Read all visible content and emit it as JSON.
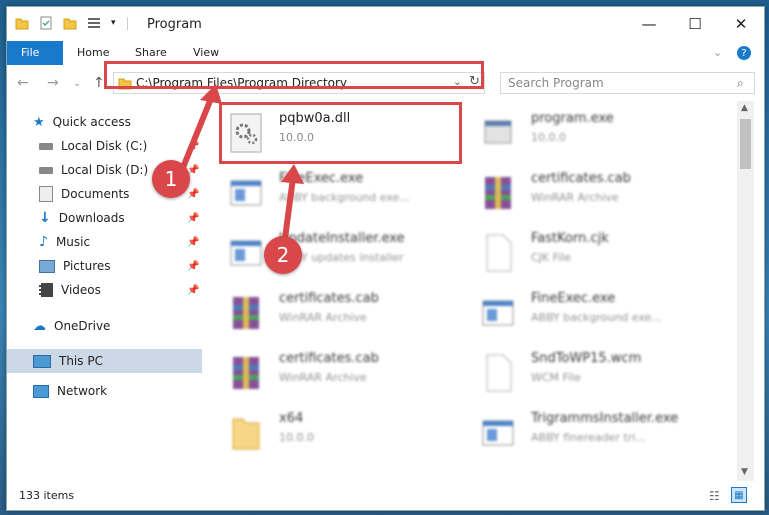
{
  "window": {
    "title": "Program"
  },
  "ribbon": {
    "tabs": [
      "File",
      "Home",
      "Share",
      "View"
    ]
  },
  "address": {
    "path": "C:\\Program Files\\Program Directory"
  },
  "search": {
    "placeholder": "Search Program"
  },
  "nav": {
    "items": [
      {
        "label": "Quick access",
        "icon": "star-icon",
        "pinned": false
      },
      {
        "label": "Local Disk (C:)",
        "icon": "drive-icon",
        "pinned": true
      },
      {
        "label": "Local Disk (D:)",
        "icon": "drive-icon",
        "pinned": true
      },
      {
        "label": "Documents",
        "icon": "documents-icon",
        "pinned": true
      },
      {
        "label": "Downloads",
        "icon": "download-icon",
        "pinned": true
      },
      {
        "label": "Music",
        "icon": "music-icon",
        "pinned": true
      },
      {
        "label": "Pictures",
        "icon": "pictures-icon",
        "pinned": true
      },
      {
        "label": "Videos",
        "icon": "videos-icon",
        "pinned": true
      },
      {
        "label": "OneDrive",
        "icon": "cloud-icon",
        "pinned": false
      },
      {
        "label": "This PC",
        "icon": "computer-icon",
        "pinned": false,
        "selected": true
      },
      {
        "label": "Network",
        "icon": "network-icon",
        "pinned": false
      }
    ]
  },
  "files": [
    {
      "name": "pqbw0a.dll",
      "sub": "10.0.0",
      "icon": "dll-gear-icon"
    },
    {
      "name": "program.exe",
      "sub": "10.0.0",
      "icon": "exe-icon"
    },
    {
      "name": "FineExec.exe",
      "sub": "ABBY background exe...",
      "icon": "window-icon"
    },
    {
      "name": "certificates.cab",
      "sub": "WinRAR Archive",
      "icon": "archive-icon"
    },
    {
      "name": "UpdateInstaller.exe",
      "sub": "ABBY updates installer",
      "icon": "window-icon"
    },
    {
      "name": "FastKorn.cjk",
      "sub": "CJK File",
      "icon": "blank-file-icon"
    },
    {
      "name": "certificates.cab",
      "sub": "WinRAR Archive",
      "icon": "archive-icon"
    },
    {
      "name": "FineExec.exe",
      "sub": "ABBY background exe...",
      "icon": "window-icon"
    },
    {
      "name": "certificates.cab",
      "sub": "WinRAR Archive",
      "icon": "archive-icon"
    },
    {
      "name": "SndToWP15.wcm",
      "sub": "WCM File",
      "icon": "blank-file-icon"
    },
    {
      "name": "x64",
      "sub": "10.0.0",
      "icon": "folder-icon"
    },
    {
      "name": "TrigrammsInstaller.exe",
      "sub": "ABBY finereader tri...",
      "icon": "window-icon"
    }
  ],
  "status": {
    "count": "133 items"
  },
  "annotations": {
    "step1": "1",
    "step2": "2",
    "accent": "#d9474a"
  }
}
